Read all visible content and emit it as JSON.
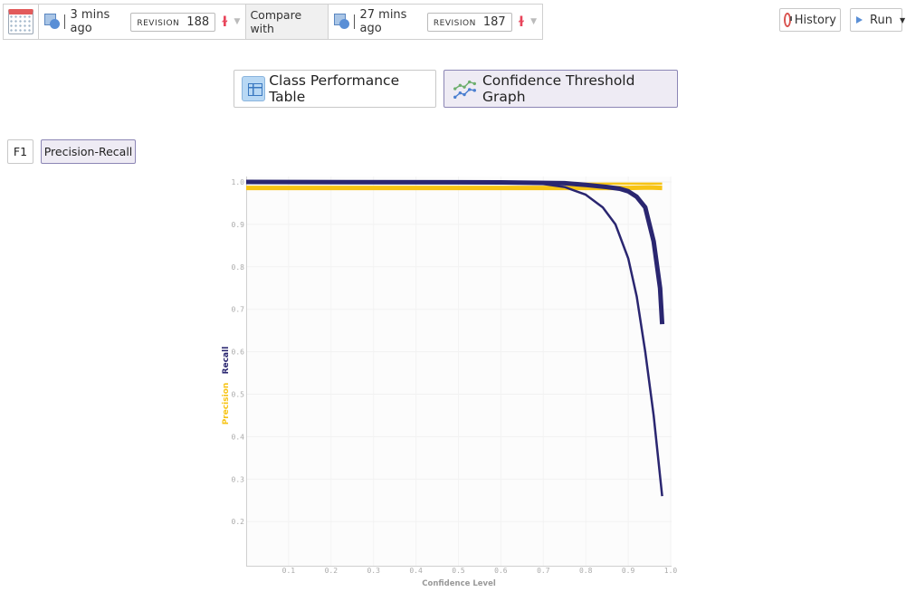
{
  "toolbar": {
    "calendar_icon": "calendar-icon",
    "current": {
      "time": "3 mins ago",
      "revision_label": "REVISION",
      "revision_number": "188"
    },
    "compare_label": "Compare with",
    "compare": {
      "time": "27 mins ago",
      "revision_label": "REVISION",
      "revision_number": "187"
    },
    "history_label": "History",
    "run_label": "Run"
  },
  "views": {
    "table_label": "Class Performance Table",
    "graph_label": "Confidence Threshold Graph",
    "active": "graph"
  },
  "metric_tabs": {
    "f1_label": "F1",
    "pr_label": "Precision-Recall",
    "active": "pr"
  },
  "colors": {
    "recall": "#2a2670",
    "precision": "#f7c415",
    "active_bg": "#eeebf4"
  },
  "chart_data": {
    "type": "line",
    "title": "",
    "xlabel": "Confidence Level",
    "ylabel_parts": [
      "Precision",
      "Recall"
    ],
    "xlim": [
      0.0,
      1.0
    ],
    "ylim": [
      0.095,
      1.0
    ],
    "xticks": [
      "0.1",
      "0.2",
      "0.3",
      "0.4",
      "0.5",
      "0.6",
      "0.7",
      "0.8",
      "0.9",
      "1.0"
    ],
    "yticks": [
      "1.0",
      "0.9",
      "0.8",
      "0.7",
      "0.6",
      "0.5",
      "0.4",
      "0.3",
      "0.2"
    ],
    "grid": true,
    "series": [
      {
        "name": "Precision (rev 187)",
        "metric": "precision",
        "revision": "187",
        "weight": "thin",
        "x": [
          0.0,
          0.5,
          0.7,
          0.75,
          0.8,
          0.85,
          0.9,
          0.95,
          0.98
        ],
        "y": [
          0.998,
          0.998,
          0.997,
          0.996,
          0.996,
          0.996,
          0.996,
          0.996,
          0.996
        ]
      },
      {
        "name": "Precision (rev 188)",
        "metric": "precision",
        "revision": "188",
        "weight": "thick",
        "x": [
          0.0,
          0.5,
          0.7,
          0.8,
          0.85,
          0.9,
          0.95,
          0.98
        ],
        "y": [
          0.986,
          0.986,
          0.986,
          0.986,
          0.986,
          0.986,
          0.987,
          0.986
        ]
      },
      {
        "name": "Recall (rev 187)",
        "metric": "recall",
        "revision": "187",
        "weight": "thin",
        "x": [
          0.0,
          0.6,
          0.7,
          0.75,
          0.8,
          0.84,
          0.87,
          0.9,
          0.92,
          0.94,
          0.96,
          0.98
        ],
        "y": [
          1.0,
          0.999,
          0.995,
          0.988,
          0.97,
          0.94,
          0.9,
          0.82,
          0.73,
          0.6,
          0.45,
          0.26
        ]
      },
      {
        "name": "Recall (rev 188)",
        "metric": "recall",
        "revision": "188",
        "weight": "thick",
        "x": [
          0.0,
          0.6,
          0.75,
          0.8,
          0.85,
          0.88,
          0.9,
          0.92,
          0.94,
          0.96,
          0.975,
          0.98
        ],
        "y": [
          1.0,
          0.999,
          0.997,
          0.993,
          0.988,
          0.984,
          0.978,
          0.965,
          0.94,
          0.86,
          0.75,
          0.665
        ]
      }
    ]
  }
}
